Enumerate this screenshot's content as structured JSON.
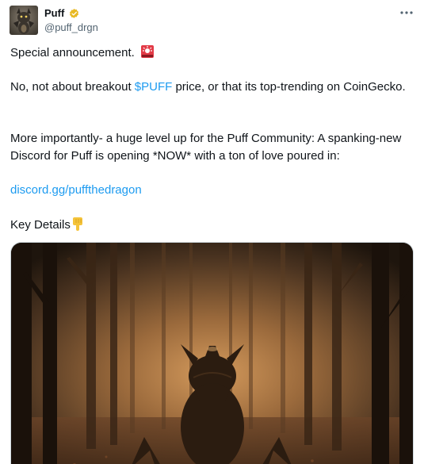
{
  "author": {
    "name": "Puff",
    "handle": "@puff_drgn",
    "verified_color": "#e8b923",
    "avatar_icon": "dragon-avatar-icon"
  },
  "more_icon": "more-horizontal-icon",
  "tweet": {
    "line1": "Special announcement.",
    "line2_pre": "No, not about breakout ",
    "line2_cashtag": "$PUFF",
    "line2_post": " price, or that its top-trending on CoinGecko.",
    "line3": "More importantly- a huge level up for the Puff Community: A spanking-new Discord for Puff is opening *NOW* with a ton of love poured in:",
    "link": "discord.gg/puffthedragon",
    "line5": "Key Details"
  },
  "colors": {
    "link": "#1d9bf0",
    "text": "#0f1419",
    "secondary": "#536471"
  },
  "media": {
    "description_icon": "dragon-in-forest-image"
  }
}
